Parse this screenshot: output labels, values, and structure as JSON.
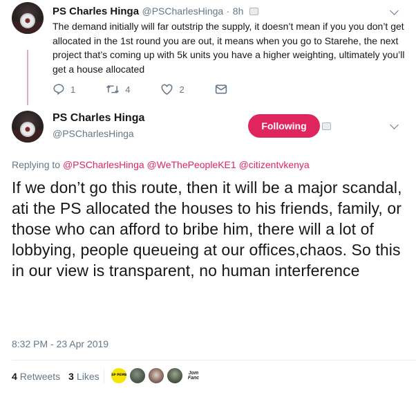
{
  "reply_tweet": {
    "author_name": "PS Charles Hinga",
    "author_handle": "@PSCharlesHinga",
    "separator": "·",
    "time": "8h",
    "text": "The demand initially will far outstrip the supply, it doesn’t mean if you you don’t get allocated in the 1st round you are out, it means when you go to Starehe, the next project that’s coming up with 5k units you have a higher weighting, ultimately you’ll get a house allocated",
    "actions": {
      "reply_count": "1",
      "retweet_count": "4",
      "like_count": "2"
    }
  },
  "main_tweet": {
    "author_name": "PS Charles Hinga",
    "author_handle": "@PSCharlesHinga",
    "follow_button_label": "Following",
    "replying_prefix": "Replying to",
    "mentions": [
      "@PSCharlesHinga",
      "@WeThePeopleKE1",
      "@citizentvkenya"
    ],
    "text": "If we don’t go this route, then it will be a major scandal, ati the PS allocated the houses to his friends, family, or those who can afford to bribe him, there will a lot of lobbying, people queueing at our offices,chaos. So this in our view is transparent, no human interference",
    "timestamp": "8:32 PM - 23 Apr 2019",
    "stats": {
      "retweets_count": "4",
      "retweets_label": "Retweets",
      "likes_count": "3",
      "likes_label": "Likes"
    },
    "likers": [
      {
        "icon": "liker-avatar-yellow",
        "caption": "SP PEMBE"
      },
      {
        "icon": "liker-avatar-1"
      },
      {
        "icon": "liker-avatar-2"
      },
      {
        "icon": "liker-avatar-3"
      },
      {
        "icon": "liker-avatar-text",
        "caption": "Jom Fanc"
      }
    ]
  },
  "colors": {
    "accent": "#e0245e",
    "muted": "#657786",
    "text": "#14171a",
    "thread_line": "#e1aebc"
  }
}
